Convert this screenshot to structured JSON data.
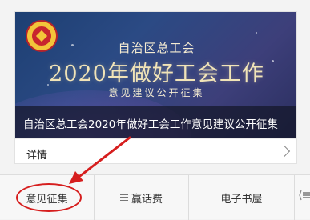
{
  "article": {
    "banner_line1": "自治区总工会",
    "banner_line2": "2020年做好工会工作",
    "banner_line3": "意见建议公开征集",
    "caption": "自治区总工会2020年做好工会工作意见建议公开征集",
    "detail_label": "详情"
  },
  "menu": {
    "tabs": [
      {
        "label": "意见征集",
        "icon": "none"
      },
      {
        "label": "赢话费",
        "icon": "menu-icon"
      },
      {
        "label": "电子书屋",
        "icon": "none"
      }
    ],
    "more_icon": "menu-icon"
  },
  "annotation": {
    "color": "#d61e1e",
    "shape": "circle-and-arrow"
  }
}
